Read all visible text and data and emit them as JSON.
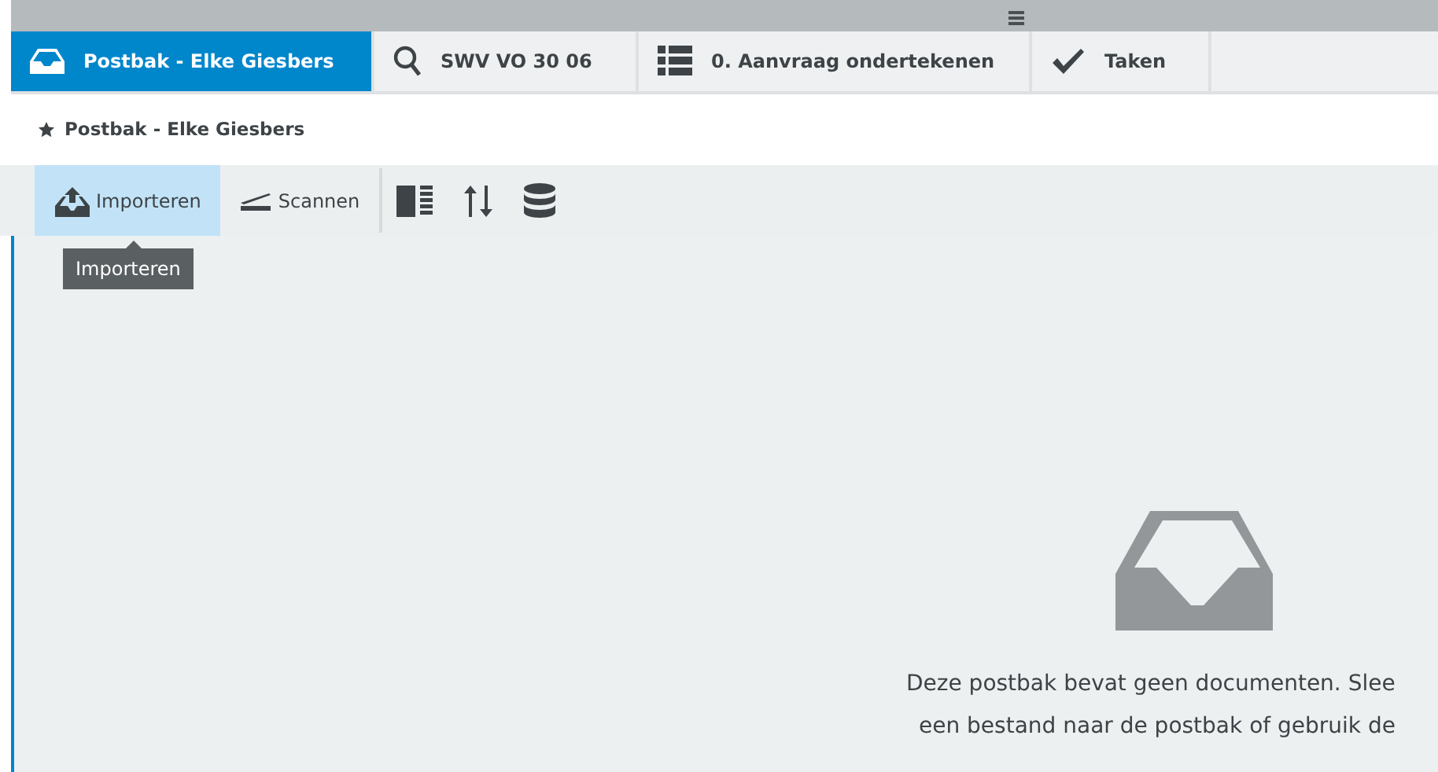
{
  "tabs": [
    {
      "label": "Postbak - Elke Giesbers",
      "kind": "inbox",
      "selected": true
    },
    {
      "label": "SWV VO 30 06",
      "kind": "search",
      "selected": false
    },
    {
      "label": "0. Aanvraag ondertekenen",
      "kind": "list",
      "selected": false
    },
    {
      "label": "Taken",
      "kind": "check",
      "selected": false
    }
  ],
  "breadcrumb": "Postbak - Elke Giesbers",
  "toolbar": [
    {
      "kind": "upload",
      "label": "Importeren",
      "selected": true
    },
    {
      "kind": "scan",
      "label": "Scannen",
      "selected": false
    },
    {
      "kind": "columns",
      "selected": false
    },
    {
      "kind": "sort",
      "selected": false
    },
    {
      "kind": "database",
      "selected": false
    }
  ],
  "tooltip": "Importeren",
  "empty_message": [
    "Deze postbak bevat geen documenten. Slee",
    "een bestand naar de postbak of gebruik de"
  ]
}
